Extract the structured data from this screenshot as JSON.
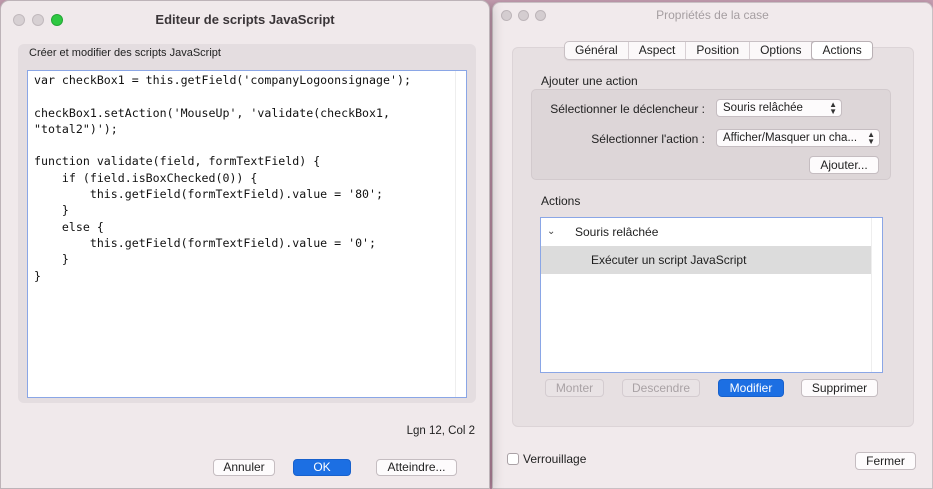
{
  "props_window": {
    "title": "Propriétés de la case",
    "tabs": [
      "Général",
      "Aspect",
      "Position",
      "Options",
      "Actions"
    ],
    "active_tab": "Actions",
    "add_action": {
      "heading": "Ajouter une action",
      "trigger_label": "Sélectionner le déclencheur :",
      "trigger_value": "Souris relâchée",
      "action_label": "Sélectionner l'action :",
      "action_value": "Afficher/Masquer un cha...",
      "add_button": "Ajouter..."
    },
    "actions_list": {
      "heading": "Actions",
      "items": [
        {
          "label": "Souris relâchée",
          "expanded_icon": "chevron-down-icon"
        },
        {
          "label": "Exécuter un script JavaScript"
        }
      ]
    },
    "buttons": {
      "up": "Monter",
      "down": "Descendre",
      "edit": "Modifier",
      "delete": "Supprimer",
      "close": "Fermer"
    },
    "lock_label": "Verrouillage"
  },
  "editor_window": {
    "title": "Editeur de scripts JavaScript",
    "description": "Créer et modifier des scripts JavaScript",
    "code": "var checkBox1 = this.getField('companyLogoonsignage');\n\ncheckBox1.setAction('MouseUp', 'validate(checkBox1,\n\"total2\")');\n\nfunction validate(field, formTextField) {\n    if (field.isBoxChecked(0)) {\n        this.getField(formTextField).value = '80';\n    }\n    else {\n        this.getField(formTextField).value = '0';\n    }\n}",
    "cursor_position": "Lgn 12, Col 2",
    "buttons": {
      "cancel": "Annuler",
      "ok": "OK",
      "goto": "Atteindre..."
    }
  },
  "colors": {
    "accent": "#1c6fe3",
    "zoom_light": "#2ec842",
    "desktop": "#c494ac"
  }
}
